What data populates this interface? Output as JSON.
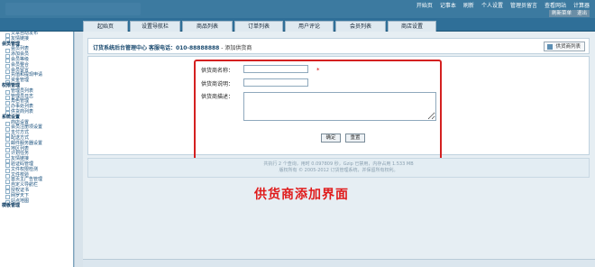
{
  "top": {
    "links": [
      "开始页",
      "记事本",
      "刷新",
      "个人设置",
      "管理员留言",
      "查看网站",
      "计算器"
    ],
    "btn1": "刷新菜单",
    "btn2": "退出"
  },
  "nav": {
    "tabs": [
      "起始页",
      "设置导航栏",
      "商品列表",
      "订单列表",
      "用户评论",
      "会员列表",
      "商店设置"
    ]
  },
  "sidebar": {
    "items": [
      {
        "label": "文章自动发布",
        "sec": false
      },
      {
        "label": "友情链接",
        "sec": false
      },
      {
        "label": "会员管理",
        "sec": true
      },
      {
        "label": "会员列表",
        "sec": false
      },
      {
        "label": "添加会员",
        "sec": false
      },
      {
        "label": "会员等级",
        "sec": false
      },
      {
        "label": "会员整合",
        "sec": false
      },
      {
        "label": "会员留言",
        "sec": false
      },
      {
        "label": "充值和提现申请",
        "sec": false
      },
      {
        "label": "资金管理",
        "sec": false
      },
      {
        "label": "权限管理",
        "sec": true
      },
      {
        "label": "管理员列表",
        "sec": false
      },
      {
        "label": "管理员日志",
        "sec": false
      },
      {
        "label": "角色管理",
        "sec": false
      },
      {
        "label": "办事处列表",
        "sec": false
      },
      {
        "label": "供货商列表",
        "sec": false
      },
      {
        "label": "系统设置",
        "sec": true
      },
      {
        "label": "商店设置",
        "sec": false
      },
      {
        "label": "会员注册项设置",
        "sec": false
      },
      {
        "label": "支付方式",
        "sec": false
      },
      {
        "label": "配送方式",
        "sec": false
      },
      {
        "label": "邮件服务器设置",
        "sec": false
      },
      {
        "label": "地区列表",
        "sec": false
      },
      {
        "label": "计划任务",
        "sec": false
      },
      {
        "label": "友情链接",
        "sec": false
      },
      {
        "label": "验证码管理",
        "sec": false
      },
      {
        "label": "文件权限检测",
        "sec": false
      },
      {
        "label": "文件校验",
        "sec": false
      },
      {
        "label": "首页主广告管理",
        "sec": false
      },
      {
        "label": "自定义导航栏",
        "sec": false
      },
      {
        "label": "授权证书",
        "sec": false
      },
      {
        "label": "网罗天下",
        "sec": false
      },
      {
        "label": "站点地图",
        "sec": false
      },
      {
        "label": "模板管理",
        "sec": true
      }
    ]
  },
  "header": {
    "title": "订货系统后台管理中心",
    "phone": "客服电话：010-88888888",
    "subtitle": " - 添加供货商",
    "list_button": "供货商列表"
  },
  "form": {
    "name_label": "供货商名称：",
    "contact_label": "供货商说明：",
    "desc_label": "供货商描述：",
    "required": "*",
    "name_value": "",
    "contact_value": "",
    "desc_value": "",
    "ok": "确定",
    "reset": "重置"
  },
  "footer": {
    "line1": "共执行 2 个查询，用时 0.097809 秒，Gzip 已禁用，内存占用 1.533 MB",
    "line2": "版权所有 © 2005-2012 订货管理系统，并保留所有权利。"
  },
  "caption": "供货商添加界面",
  "colors": {
    "topbar": "#3c7aa0",
    "navbar": "#2f6f98",
    "highlight": "#d42020",
    "caption": "#e01b1b"
  }
}
